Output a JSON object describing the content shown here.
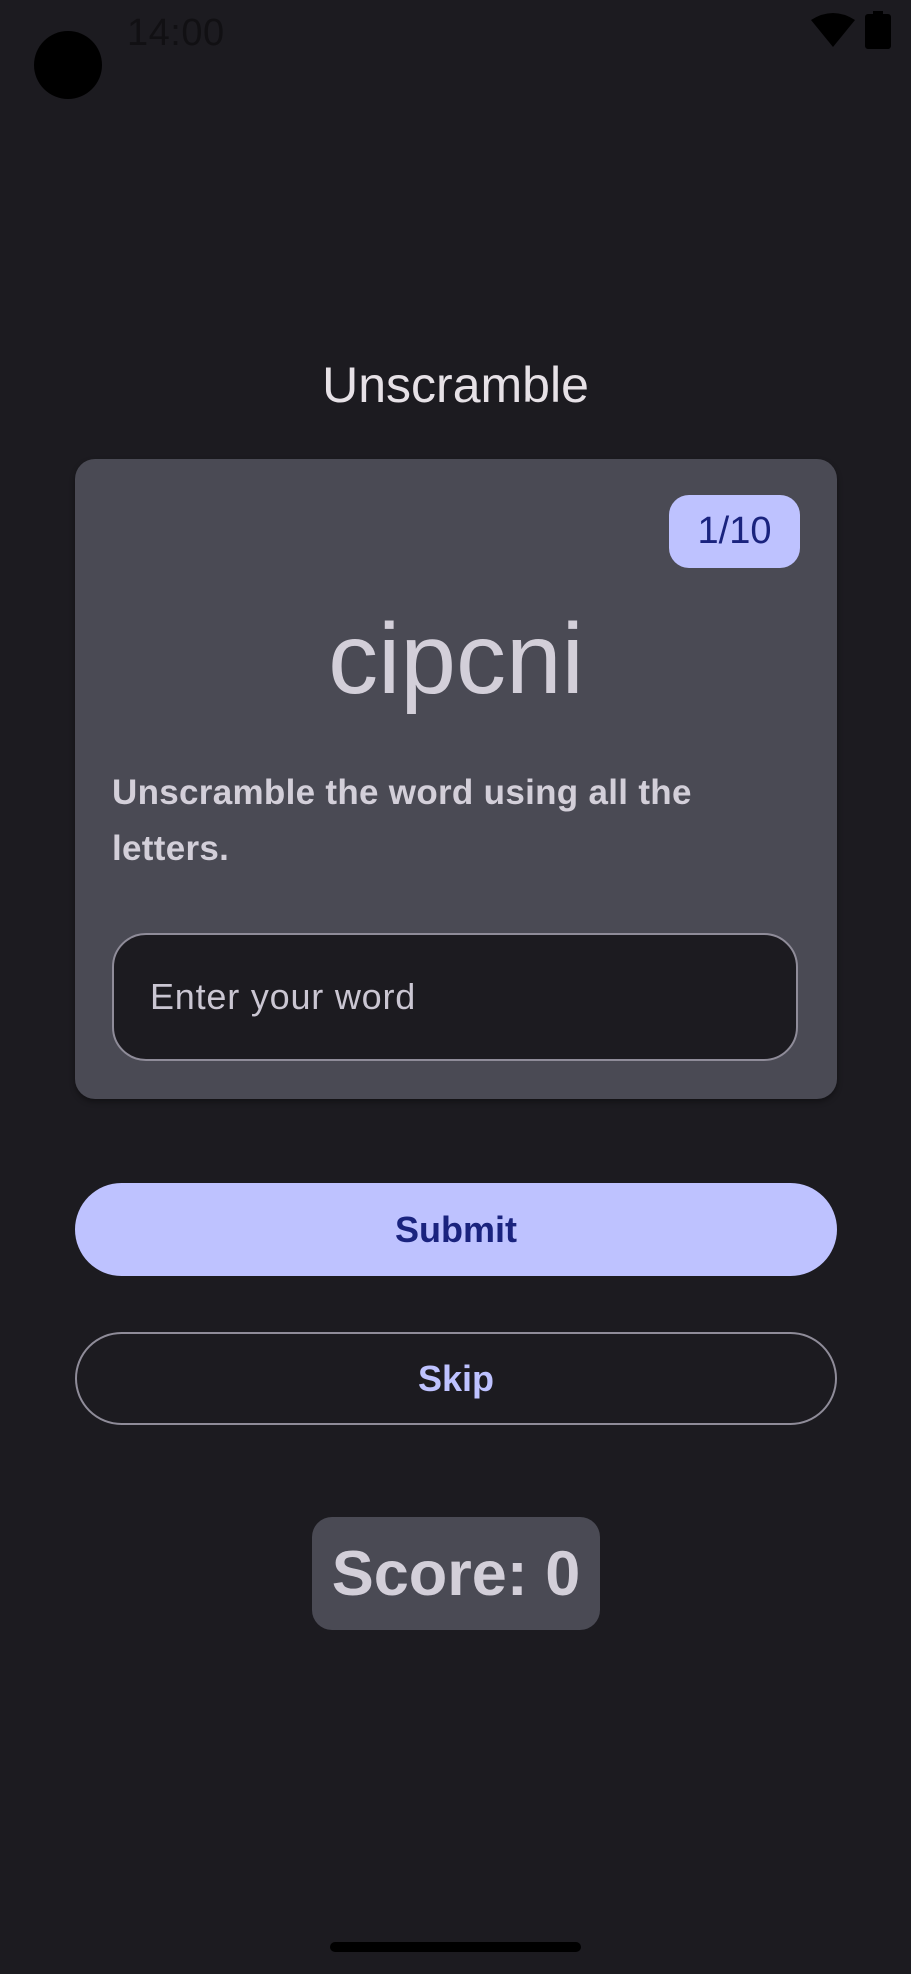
{
  "status_bar": {
    "time": "14:00",
    "icons": [
      "camera-cutout",
      "wifi-icon",
      "battery-icon"
    ]
  },
  "app": {
    "title": "Unscramble"
  },
  "game": {
    "word_count": "1/10",
    "scrambled_word": "cipcni",
    "instructions": "Unscramble the word using all the letters.",
    "input": {
      "value": "",
      "placeholder": "Enter your word"
    },
    "submit_label": "Submit",
    "skip_label": "Skip",
    "score": "Score: 0"
  },
  "colors": {
    "background": "#1c1b20",
    "card": "#4a4a54",
    "accent": "#bec2ff",
    "on_accent": "#1a237e",
    "text": "#d3cfd9"
  }
}
